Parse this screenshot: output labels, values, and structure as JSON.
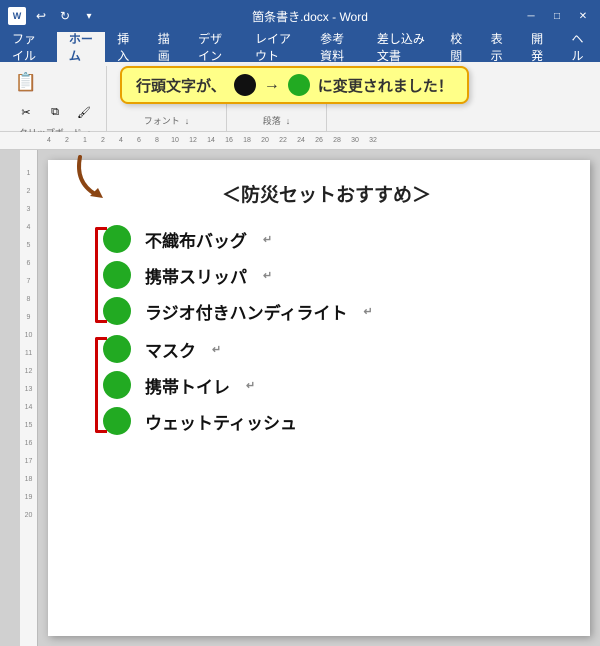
{
  "titlebar": {
    "filename": "箇条書き.docx",
    "app": "Word",
    "title": "箇条書き.docx - Word"
  },
  "ribbon": {
    "tabs": [
      "ファイル",
      "ホーム",
      "挿入",
      "描画",
      "デザイン",
      "レイアウト",
      "参考資料",
      "差し込み文書",
      "校閲",
      "表示",
      "開発",
      "ヘル"
    ],
    "active_tab": "ホーム",
    "groups": [
      "クリップボード",
      "フォント",
      "段落"
    ]
  },
  "notification": {
    "text_before": "行頭文字が、",
    "arrow": "→",
    "text_after": "に変更されました！"
  },
  "document": {
    "title": "＜防災セットおすすめ＞",
    "items": [
      {
        "text": "不織布バッグ",
        "para": "↵"
      },
      {
        "text": "携帯スリッパ",
        "para": "↵"
      },
      {
        "text": "ラジオ付きハンディライト",
        "para": "↵"
      },
      {
        "text": "マスク",
        "para": "↵"
      },
      {
        "text": "携帯トイレ",
        "para": "↵"
      },
      {
        "text": "ウェットティッシュ",
        "para": ""
      }
    ]
  },
  "ruler": {
    "numbers": [
      "4",
      "2",
      "1",
      "2",
      "4",
      "6",
      "8",
      "10",
      "12",
      "14",
      "16",
      "18",
      "20",
      "22",
      "24",
      "26",
      "28",
      "30",
      "32"
    ]
  },
  "side_ruler": {
    "numbers": [
      "1",
      "2",
      "3",
      "4",
      "5",
      "6",
      "7",
      "8",
      "9",
      "10",
      "11",
      "12",
      "13",
      "14",
      "15",
      "16",
      "17",
      "18",
      "19",
      "20"
    ]
  }
}
